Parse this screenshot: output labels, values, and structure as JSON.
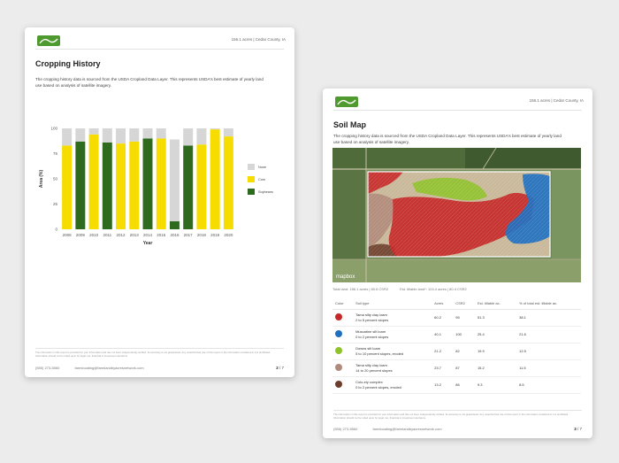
{
  "colors": {
    "corn": "#f7dc00",
    "soybeans": "#2e6b1f",
    "none": "#d6d6d6"
  },
  "left_page": {
    "header_right": "156.1 acres | Cedar County, IA",
    "title": "Cropping History",
    "description": "The cropping history data is sourced from the USDA Cropland Data Layer. This represents USDA's best estimate of yearly land use based on analysis of satellite imagery.",
    "footer_text": "The information in this report is provided for your information and has not been independently verified. Its accuracy is not guaranteed. Any unauthorized use of this report or the information contained in it is prohibited. Information should not be relied upon for legal, tax, financial or investment decisions.",
    "footer_phone": "(555) 273-5560",
    "footer_email": "farmlocating@farmlandbyacresnetwork.com",
    "page_number": "2",
    "page_total": "/ 7"
  },
  "chart_data": {
    "type": "bar",
    "stacked": true,
    "title": "",
    "xlabel": "Year",
    "ylabel": "Area (%)",
    "ylim": [
      0,
      100
    ],
    "yticks": [
      0,
      25,
      50,
      75,
      100
    ],
    "categories": [
      "2008",
      "2009",
      "2010",
      "2011",
      "2012",
      "2013",
      "2014",
      "2015",
      "2016",
      "2017",
      "2018",
      "2019",
      "2020"
    ],
    "series": [
      {
        "name": "Corn",
        "color": "#f7dc00",
        "values": [
          83,
          0,
          94,
          0,
          85,
          87,
          0,
          90,
          0,
          0,
          84,
          99,
          92
        ]
      },
      {
        "name": "Soybeans",
        "color": "#2e6b1f",
        "values": [
          0,
          87,
          0,
          86,
          0,
          0,
          90,
          0,
          8,
          83,
          0,
          0,
          0
        ]
      },
      {
        "name": "None",
        "color": "#d6d6d6",
        "values": [
          17,
          13,
          6,
          14,
          15,
          13,
          10,
          10,
          81,
          17,
          16,
          1,
          8
        ]
      }
    ],
    "legend_placement": "right",
    "grid": false
  },
  "right_page": {
    "header_right": "156.1 acres | Cedar County, IA",
    "title": "Soil Map",
    "description": "The cropping history data is sourced from the USDA Cropland Data Layer. This represents USDA's best estimate of yearly land use based on analysis of satellite imagery.",
    "map_attribution": "mapbox",
    "total_land": "Total land: 156.1 acres | 80.6 CSR2",
    "total_tillable": "Est. tillable land*: 124.4 acres | 80.4 CSR2",
    "columns": [
      "Color",
      "Soil type",
      "Acres",
      "CSR2",
      "Est. tillable ac.",
      "% of total est. tillable ac."
    ],
    "rows": [
      {
        "color": "#c62828",
        "soil": "Tama silty clay loam",
        "soil2": "2 to 5 percent slopes",
        "acres": "60.2",
        "csr2": "95",
        "tillable": "51.3",
        "pct": "38.1"
      },
      {
        "color": "#1f6fc0",
        "soil": "Muscatine silt loam",
        "soil2": "0 to 2 percent slopes",
        "acres": "40.1",
        "csr2": "100",
        "tillable": "25.4",
        "pct": "21.6"
      },
      {
        "color": "#8fc22b",
        "soil": "Downs silt loam",
        "soil2": "5 to 10 percent slopes, eroded",
        "acres": "21.2",
        "csr2": "82",
        "tillable": "19.9",
        "pct": "12.5"
      },
      {
        "color": "#b08a7a",
        "soil": "Tama silty clay loam",
        "soil2": "14 to 20 percent slopes",
        "acres": "23.7",
        "csr2": "87",
        "tillable": "15.2",
        "pct": "11.5"
      },
      {
        "color": "#6b3d2a",
        "soil": "Colo-ely complex",
        "soil2": "0 to 2 percent slopes, eroded",
        "acres": "13.2",
        "csr2": "86",
        "tillable": "9.3",
        "pct": "8.5"
      }
    ],
    "footer_text": "The information in this report is provided for your information and has not been independently verified. Its accuracy is not guaranteed. Any unauthorized use of this report or the information contained in it is prohibited. Information should not be relied upon for legal, tax, financial or investment decisions.",
    "footer_phone": "(555) 273-5560",
    "footer_email": "farmlocating@farmlandbyacresnetwork.com",
    "page_number": "3",
    "page_total": "/ 7"
  }
}
